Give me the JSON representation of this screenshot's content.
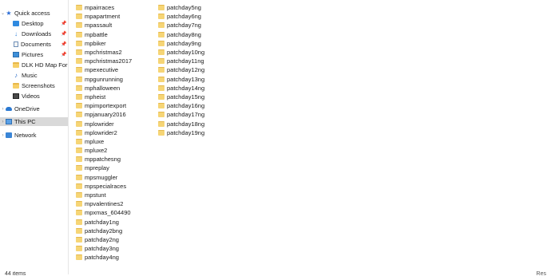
{
  "nav": {
    "quick_access": "Quick access",
    "desktop": "Desktop",
    "downloads": "Downloads",
    "documents": "Documents",
    "pictures": "Pictures",
    "dlk": "DLK HD Map For",
    "music": "Music",
    "screenshots": "Screenshots",
    "videos": "Videos",
    "onedrive": "OneDrive",
    "this_pc": "This PC",
    "network": "Network"
  },
  "files": {
    "col1": [
      "mpairraces",
      "mpapartment",
      "mpassault",
      "mpbattle",
      "mpbiker",
      "mpchristmas2",
      "mpchristmas2017",
      "mpexecutive",
      "mpgunrunning",
      "mphalloween",
      "mpheist",
      "mpimportexport",
      "mpjanuary2016",
      "mplowrider",
      "mplowrider2",
      "mpluxe",
      "mpluxe2",
      "mppatchesng",
      "mpreplay",
      "mpsmuggler",
      "mpspecialraces",
      "mpstunt",
      "mpvalentines2",
      "mpxmas_604490",
      "patchday1ng",
      "patchday2bng",
      "patchday2ng",
      "patchday3ng",
      "patchday4ng"
    ],
    "col2": [
      "patchday5ng",
      "patchday6ng",
      "patchday7ng",
      "patchday8ng",
      "patchday9ng",
      "patchday10ng",
      "patchday11ng",
      "patchday12ng",
      "patchday13ng",
      "patchday14ng",
      "patchday15ng",
      "patchday16ng",
      "patchday17ng",
      "patchday18ng",
      "patchday19ng"
    ]
  },
  "status": {
    "item_count": "44 items",
    "right_text": "Res"
  },
  "colors": {
    "selected_nav": "#d9d9d9",
    "folder": "#f6d576"
  }
}
